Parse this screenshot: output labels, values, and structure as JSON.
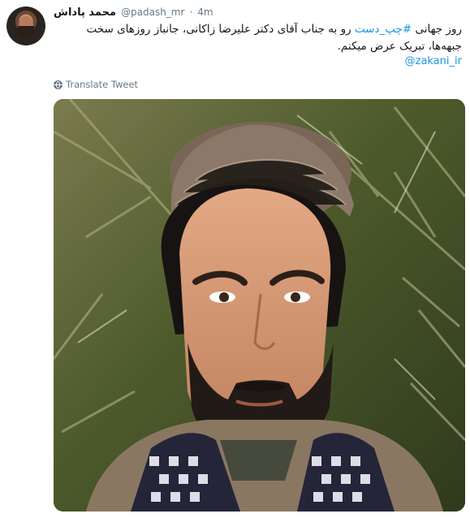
{
  "tweet": {
    "author_name": "محمد پاداش",
    "handle": "@padash_mr",
    "separator": "·",
    "time": "4m",
    "text_before_hashtag": "روز جهانی ",
    "hashtag": "#چپ_دست",
    "text_after_hashtag": " رو به جناب آقای دکتر علیرضا زاکانی، جانباز روزهای سخت جبهه‌ها، تبریک عرض میکنم.",
    "mention": "@zakani_ir",
    "translate_label": "Translate Tweet"
  },
  "icons": {
    "avatar": "avatar",
    "translate": "globe-icon"
  },
  "colors": {
    "link": "#1b95e0",
    "secondary_text": "#657786",
    "primary_text": "#14171a"
  }
}
